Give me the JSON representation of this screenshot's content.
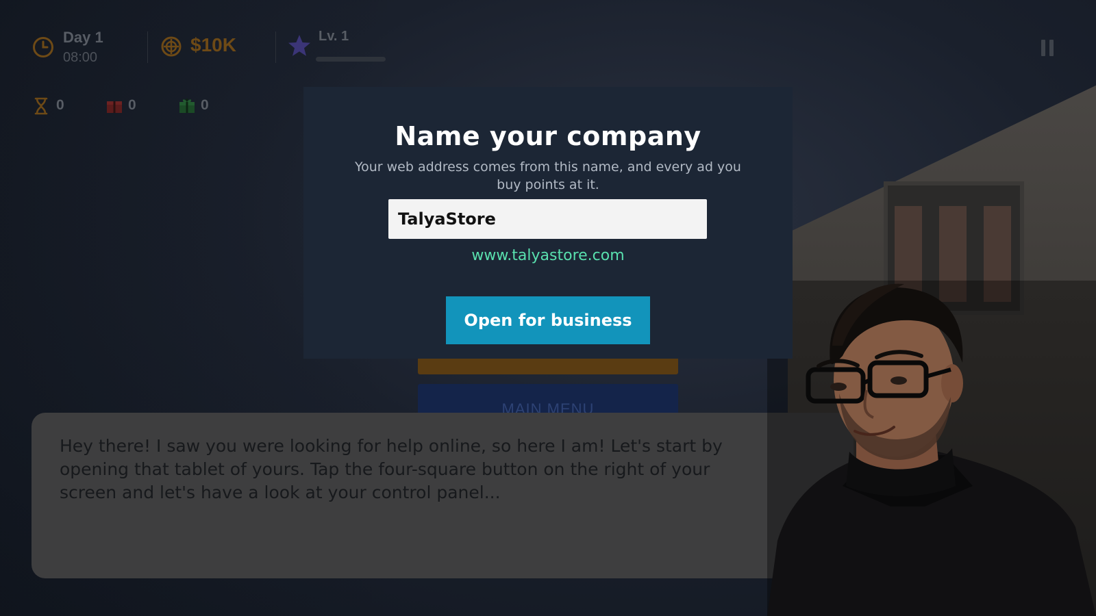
{
  "hud": {
    "day": "Day 1",
    "time": "08:00",
    "money": "$10K",
    "level": "Lv. 1",
    "xp_progress": 0,
    "stats": [
      {
        "icon": "hourglass-icon",
        "value": "0"
      },
      {
        "icon": "red-gift-icon",
        "value": "0"
      },
      {
        "icon": "green-gift-icon",
        "value": "0"
      }
    ]
  },
  "background_menu": {
    "main_menu_label": "MAIN MENU"
  },
  "modal": {
    "title": "Name your company",
    "subtitle": "Your web address comes from this name, and every ad you buy points at it.",
    "company_name_value": "TalyaStore",
    "web_address": "www.talyastore.com",
    "submit_label": "Open for business"
  },
  "dialogue": {
    "text": "Hey there! I saw you were looking for help online, so here I am! Let's start by opening that tablet of yours. Tap the four-square button on the right of your screen and let's have a look at your control panel..."
  },
  "colors": {
    "accent_button": "#1294bb",
    "web_address": "#59e0ae",
    "money": "#6e4a16",
    "modal_bg": "#1c2635"
  }
}
